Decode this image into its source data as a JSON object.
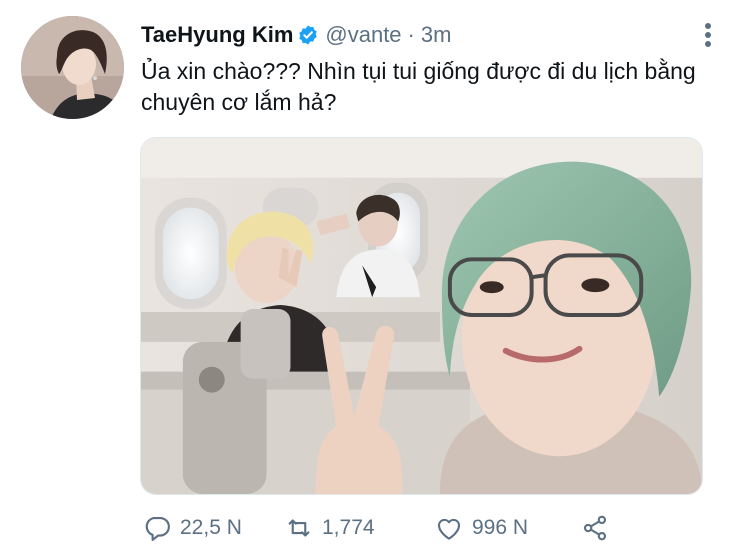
{
  "tweet": {
    "author_name": "TaeHyung Kim",
    "handle": "@vante",
    "separator": "·",
    "time": "3m",
    "text": "Ủa xin chào??? Nhìn tụi tui giống được đi du lịch bằng chuyên cơ lắm hả?",
    "verified": true
  },
  "actions": {
    "replies": "22,5 N",
    "retweets": "1,774",
    "likes": "996 N"
  },
  "icons": {
    "verified": "verified-badge-icon",
    "more": "more-options-icon",
    "reply": "reply-icon",
    "retweet": "retweet-icon",
    "like": "heart-icon",
    "share": "share-icon"
  },
  "colors": {
    "verified_blue": "#1da1f2",
    "secondary_text": "#5b7083",
    "primary_text": "#0f1419"
  }
}
